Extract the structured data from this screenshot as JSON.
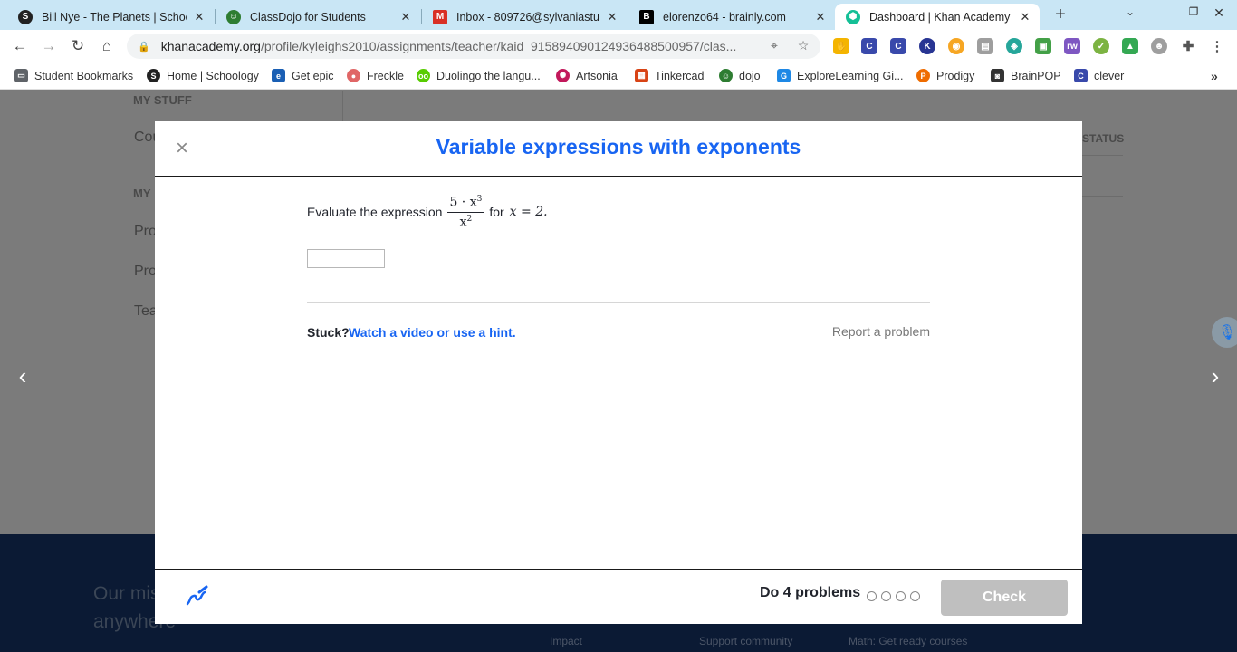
{
  "tabs": [
    {
      "title": "Bill Nye - The Planets | Schoology",
      "icon": "schoology-icon",
      "color": "#1f1f1f"
    },
    {
      "title": "ClassDojo for Students",
      "icon": "classdojo-icon",
      "color": "#2e7d32"
    },
    {
      "title": "Inbox - 809726@sylvaniastudents",
      "icon": "gmail-icon",
      "color": "#d93025"
    },
    {
      "title": "elorenzo64 - brainly.com",
      "icon": "brainly-icon",
      "color": "#000000"
    },
    {
      "title": "Dashboard | Khan Academy",
      "icon": "khan-academy-icon",
      "color": "#14bf96"
    }
  ],
  "address": {
    "host": "khanacademy.org",
    "path": "/profile/kyleighs2010/assignments/teacher/kaid_915894090124936488500957/clas..."
  },
  "bookmarks": [
    {
      "label": "Student Bookmarks",
      "icon": "folder-icon",
      "color": "#5f6368"
    },
    {
      "label": "Home | Schoology",
      "icon": "schoology-icon",
      "color": "#1f1f1f"
    },
    {
      "label": "Get epic",
      "icon": "epic-icon",
      "color": "#1a5fb4"
    },
    {
      "label": "Freckle",
      "icon": "freckle-icon",
      "color": "#e06666"
    },
    {
      "label": "Duolingo the langu...",
      "icon": "duolingo-icon",
      "color": "#58cc02"
    },
    {
      "label": "Artsonia",
      "icon": "artsonia-icon",
      "color": "#c2185b"
    },
    {
      "label": "Tinkercad",
      "icon": "tinkercad-icon",
      "color": "#d84315"
    },
    {
      "label": "dojo",
      "icon": "classdojo-icon",
      "color": "#2e7d32"
    },
    {
      "label": "ExploreLearning Gi...",
      "icon": "explorelearning-icon",
      "color": "#1e88e5"
    },
    {
      "label": "Prodigy",
      "icon": "prodigy-icon",
      "color": "#ef6c00"
    },
    {
      "label": "BrainPOP",
      "icon": "brainpop-icon",
      "color": "#333333"
    },
    {
      "label": "clever",
      "icon": "clever-icon",
      "color": "#3949ab"
    }
  ],
  "background": {
    "my_stuff": "MY STUFF",
    "courses": "Cou",
    "my_section": "MY",
    "items": [
      "Pro",
      "Pro",
      "Tea"
    ],
    "status_header": "STATUS",
    "mission": "Our mis... educatio... ... anywhere",
    "footer_links": [
      "Impact",
      "Support community",
      "Math: Get ready courses"
    ]
  },
  "modal": {
    "title": "Variable expressions with exponents",
    "question_prefix": "Evaluate the expression",
    "fraction_numerator": "5 · x",
    "numerator_exponent": "3",
    "fraction_denominator": "x",
    "denominator_exponent": "2",
    "question_mid": "for",
    "question_condition": "x = 2.",
    "answer_value": "",
    "stuck_label": "Stuck?",
    "hint_link": "Watch a video or use a hint.",
    "report_link": "Report a problem",
    "do_problems": "Do 4 problems",
    "progress_total": 4,
    "progress_done": 0,
    "check_label": "Check"
  },
  "colors": {
    "accent": "#1865f2",
    "check_disabled": "#bfbfbf"
  }
}
